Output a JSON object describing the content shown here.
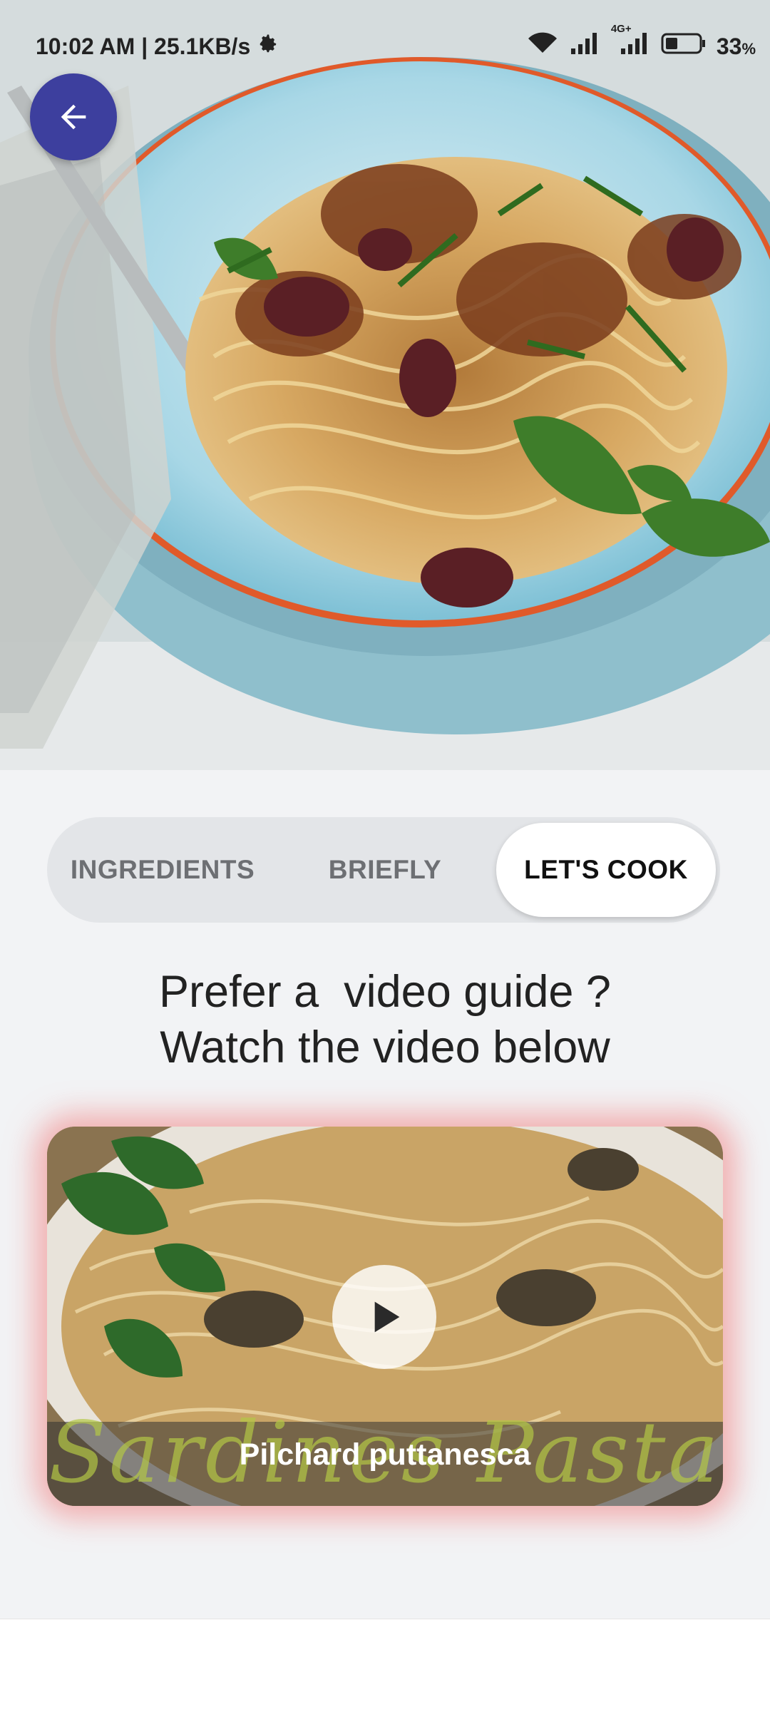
{
  "status_bar": {
    "time_speed": "10:02 AM | 25.1KB/s",
    "battery": "33",
    "battery_unit": "%",
    "network_label": "4G+",
    "icons": [
      "settings-gear-icon",
      "wifi-icon",
      "signal-icon",
      "signal-4g-icon",
      "battery-icon"
    ]
  },
  "header": {
    "back_icon": "arrow-left-icon"
  },
  "tabs": [
    {
      "label": "INGREDIENTS",
      "active": false
    },
    {
      "label": "BRIEFLY",
      "active": false
    },
    {
      "label": "LET'S COOK",
      "active": true
    }
  ],
  "content": {
    "headline_line1": "Prefer a  video guide ?",
    "headline_line2": "Watch the video below"
  },
  "video": {
    "title": "Pilchard puttanesca",
    "overlay_text": "Sardines Pasta",
    "play_icon": "play-icon"
  },
  "colors": {
    "accent": "#3d3f9e",
    "video_glow": "#f07878",
    "background": "#f2f3f5"
  }
}
